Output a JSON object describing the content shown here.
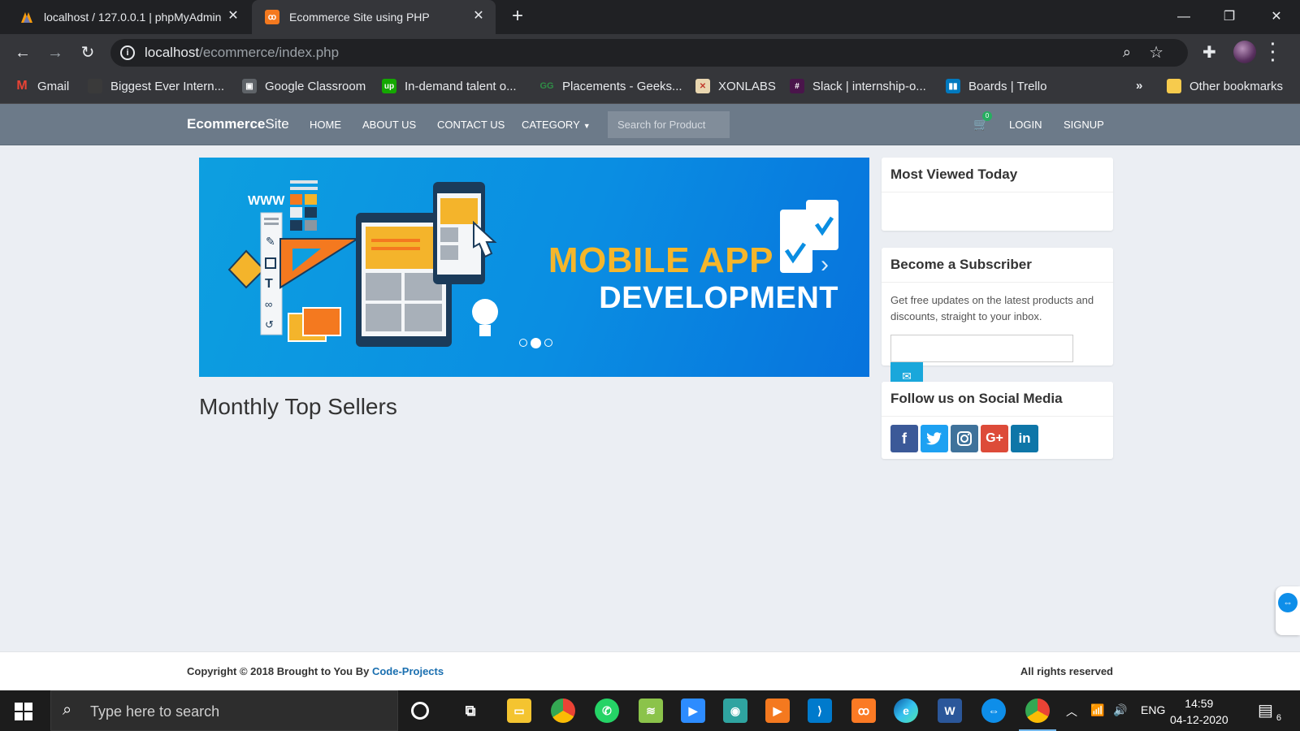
{
  "browser": {
    "tabs": [
      {
        "title": "localhost / 127.0.0.1 | phpMyAdmin",
        "active": false
      },
      {
        "title": "Ecommerce Site using PHP",
        "active": true
      }
    ],
    "new_tab_label": "+",
    "address": {
      "host": "localhost",
      "path": "/ecommerce/index.php"
    },
    "bookmarks": [
      {
        "label": "Gmail",
        "icon": "gmail-icon",
        "color": "#ea4335"
      },
      {
        "label": "Biggest Ever Intern...",
        "icon": "bookmark-favicon",
        "color": "#3a3a3a"
      },
      {
        "label": "Google Classroom",
        "icon": "classroom-icon",
        "color": "#5f6368"
      },
      {
        "label": "In-demand talent o...",
        "icon": "upwork-icon",
        "color": "#14a800"
      },
      {
        "label": "Placements - Geeks...",
        "icon": "geeksforgeeks-icon",
        "color": "#2f8d46"
      },
      {
        "label": "XONLABS",
        "icon": "xonlabs-icon",
        "color": "#c0392b"
      },
      {
        "label": "Slack | internship-o...",
        "icon": "slack-icon",
        "color": "#4a154b"
      },
      {
        "label": "Boards | Trello",
        "icon": "trello-icon",
        "color": "#0079bf"
      }
    ],
    "overflow_label": "»",
    "other_bookmarks": "Other bookmarks"
  },
  "site": {
    "brand_bold": "Ecommerce",
    "brand_rest": "Site",
    "nav": [
      "HOME",
      "ABOUT US",
      "CONTACT US",
      "CATEGORY"
    ],
    "search_placeholder": "Search for Product",
    "cart_count": "0",
    "login": "LOGIN",
    "signup": "SIGNUP"
  },
  "carousel": {
    "headline_1": "MOBILE APP",
    "headline_2": "DEVELOPMENT",
    "slide_label": "WWW",
    "slide_count": 3,
    "active_slide": 2
  },
  "main": {
    "section_title": "Monthly Top Sellers"
  },
  "sidebar": {
    "most_viewed_title": "Most Viewed Today",
    "subscribe_title": "Become a Subscriber",
    "subscribe_text": "Get free updates on the latest products and discounts, straight to your inbox.",
    "social_title": "Follow us on Social Media",
    "social": [
      {
        "name": "facebook-icon",
        "glyph": "f",
        "color": "#3b5998"
      },
      {
        "name": "twitter-icon",
        "glyph": "t",
        "color": "#1da1f2"
      },
      {
        "name": "instagram-icon",
        "glyph": "◎",
        "color": "#3f729b"
      },
      {
        "name": "google-plus-icon",
        "glyph": "G+",
        "color": "#dd4b39"
      },
      {
        "name": "linkedin-icon",
        "glyph": "in",
        "color": "#0e76a8"
      }
    ]
  },
  "footer": {
    "copyright": "Copyright © 2018 Brought to You By ",
    "copyright_link": "Code-Projects",
    "rights": "All rights reserved"
  },
  "taskbar": {
    "search_placeholder": "Type here to search",
    "language": "ENG",
    "time": "14:59",
    "date": "04-12-2020",
    "notifications": "6"
  }
}
